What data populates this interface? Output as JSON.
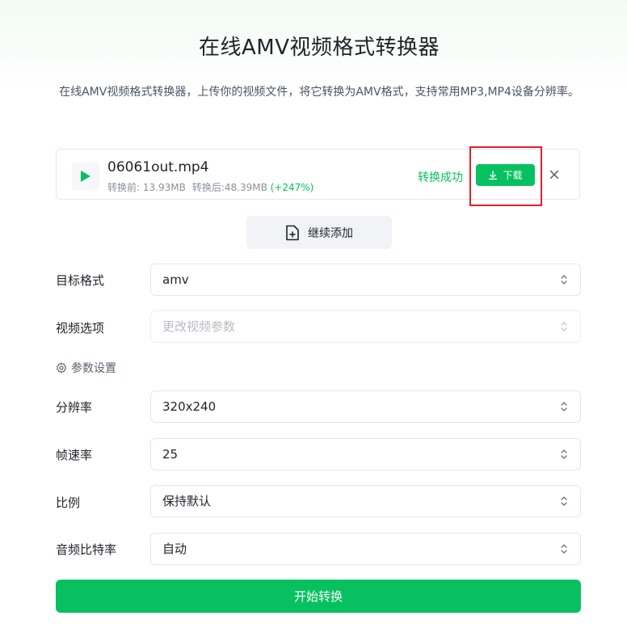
{
  "page": {
    "title": "在线AMV视频格式转换器",
    "description": "在线AMV视频格式转换器，上传你的视频文件，将它转换为AMV格式，支持常用MP3,MP4设备分辨率。"
  },
  "file": {
    "name": "06061out.mp4",
    "size_before": "转换前: 13.93MB",
    "size_after": "转换后:48.39MB",
    "size_change": "(+247%)",
    "status": "转换成功",
    "download_label": "下载"
  },
  "add_more_label": "继续添加",
  "form": {
    "target_format": {
      "label": "目标格式",
      "value": "amv"
    },
    "video_options": {
      "label": "视频选项",
      "placeholder": "更改视频参数"
    },
    "params_label": "参数设置",
    "resolution": {
      "label": "分辨率",
      "value": "320x240"
    },
    "frame_rate": {
      "label": "帧速率",
      "value": "25"
    },
    "aspect_ratio": {
      "label": "比例",
      "value": "保持默认"
    },
    "audio_bitrate": {
      "label": "音频比特率",
      "value": "自动"
    }
  },
  "start_label": "开始转换",
  "colors": {
    "accent": "#07c160",
    "highlight": "#e0202b"
  },
  "icons": {
    "play": "play-icon",
    "download": "download-icon",
    "close": "close-icon",
    "add_file": "file-plus-icon",
    "gear": "gear-icon",
    "chevron": "chevron-up-down-icon"
  }
}
